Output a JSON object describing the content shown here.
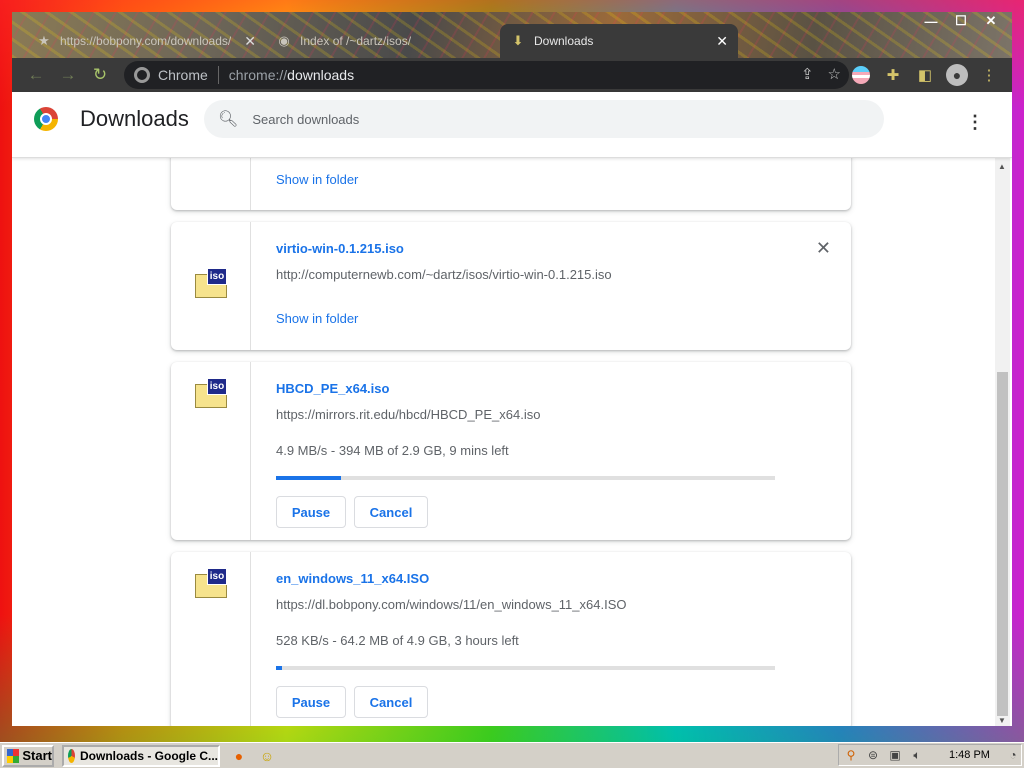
{
  "browser": {
    "tabs": [
      {
        "title": "https://bobpony.com/downloads/",
        "icon": "bookmark-star-icon",
        "active": false
      },
      {
        "title": "Index of /~dartz/isos/",
        "icon": "globe-icon",
        "active": false
      },
      {
        "title": "Downloads",
        "icon": "download-icon",
        "active": true
      }
    ],
    "window_controls": {
      "minimize": "—",
      "maximize": "☐",
      "close": "✕"
    },
    "omnibox": {
      "chip": "Chrome",
      "scheme": "chrome://",
      "host": "downloads"
    }
  },
  "page": {
    "title": "Downloads",
    "search_placeholder": "Search downloads",
    "show_in_folder_label": "Show in folder",
    "pause_label": "Pause",
    "cancel_label": "Cancel",
    "downloads": [
      {
        "filename": "virtio-win-0.1.215.iso",
        "url": "http://computernewb.com/~dartz/isos/virtio-win-0.1.215.iso",
        "state": "complete"
      },
      {
        "filename": "HBCD_PE_x64.iso",
        "url": "https://mirrors.rit.edu/hbcd/HBCD_PE_x64.iso",
        "status": "4.9 MB/s - 394 MB of 2.9 GB, 9 mins left",
        "progress": 0.13,
        "state": "in_progress"
      },
      {
        "filename": "en_windows_11_x64.ISO",
        "url": "https://dl.bobpony.com/windows/11/en_windows_11_x64.ISO",
        "status": "528 KB/s - 64.2 MB of 4.9 GB, 3 hours left",
        "progress": 0.013,
        "state": "in_progress"
      }
    ],
    "file_badge": "iso"
  },
  "taskbar": {
    "start_label": "Start",
    "task_item": "Downloads - Google C...",
    "clock": "1:48 PM"
  },
  "colors": {
    "accent": "#1a73e8",
    "toolbar": "#3a3a3a",
    "taskbar": "#d4d0c8"
  }
}
